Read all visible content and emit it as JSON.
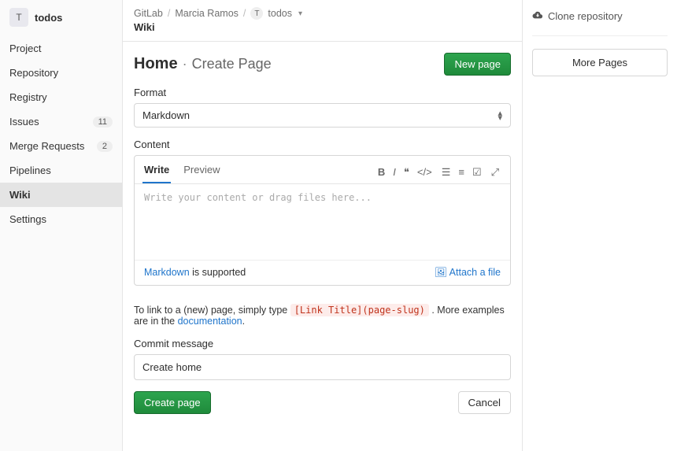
{
  "sidebar": {
    "project_letter": "T",
    "project_name": "todos",
    "items": [
      {
        "label": "Project",
        "badge": ""
      },
      {
        "label": "Repository",
        "badge": ""
      },
      {
        "label": "Registry",
        "badge": ""
      },
      {
        "label": "Issues",
        "badge": "11"
      },
      {
        "label": "Merge Requests",
        "badge": "2"
      },
      {
        "label": "Pipelines",
        "badge": ""
      },
      {
        "label": "Wiki",
        "badge": ""
      },
      {
        "label": "Settings",
        "badge": ""
      }
    ],
    "active_index": 6
  },
  "breadcrumb": {
    "root": "GitLab",
    "owner": "Marcia Ramos",
    "project_letter": "T",
    "project": "todos",
    "subtitle": "Wiki"
  },
  "header": {
    "title": "Home",
    "suffix": "Create Page",
    "new_page": "New page"
  },
  "form": {
    "format_label": "Format",
    "format_value": "Markdown",
    "content_label": "Content",
    "tabs": {
      "write": "Write",
      "preview": "Preview"
    },
    "placeholder": "Write your content or drag files here...",
    "md_link": "Markdown",
    "md_supported": " is supported",
    "attach": "Attach a file",
    "hint_pre": "To link to a (new) page, simply type ",
    "hint_code": "[Link Title](page-slug)",
    "hint_post": " . More examples are in the ",
    "hint_doc": "documentation",
    "hint_end": ".",
    "commit_label": "Commit message",
    "commit_value": "Create home",
    "submit": "Create page",
    "cancel": "Cancel"
  },
  "right": {
    "clone": "Clone repository",
    "more": "More Pages"
  }
}
